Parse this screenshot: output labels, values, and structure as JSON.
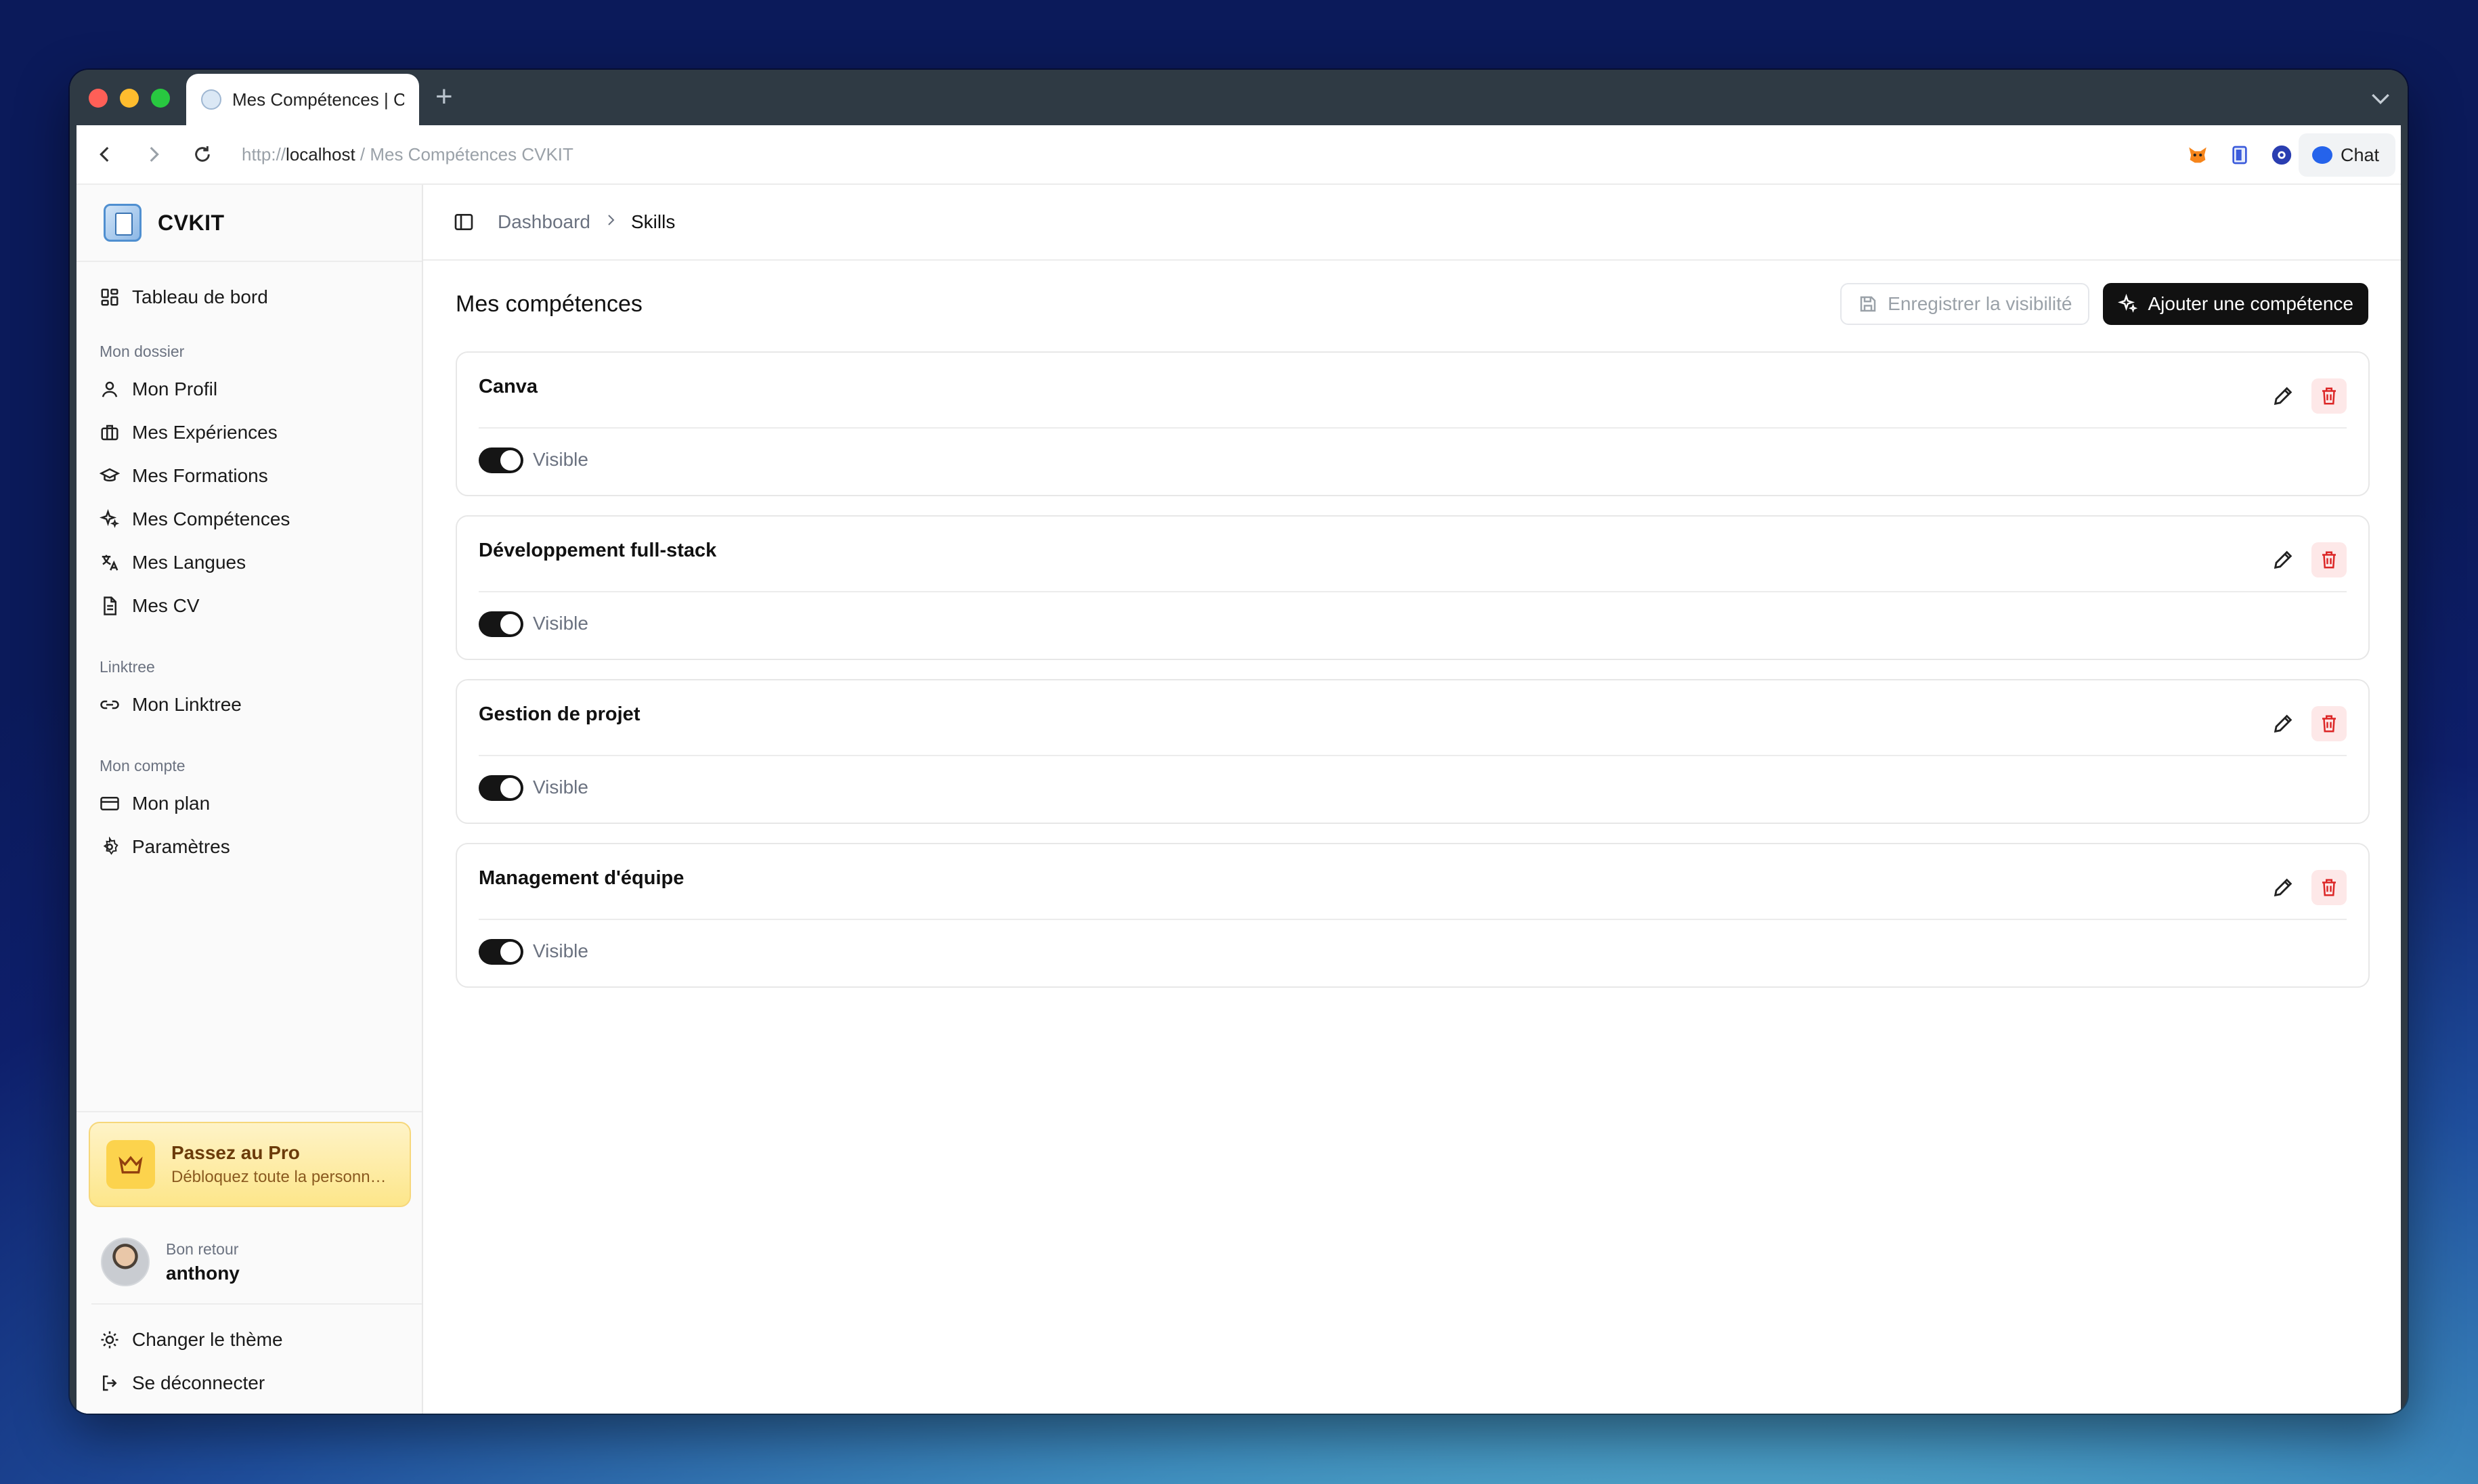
{
  "browser": {
    "tab_title": "Mes Compétences | C\\",
    "new_tab": "+",
    "url_scheme": "http://",
    "url_host": "localhost",
    "url_rest": " / Mes Compétences CVKIT",
    "chat_label": "Chat"
  },
  "sidebar": {
    "brand": "CVKIT",
    "dashboard": "Tableau de bord",
    "section_dossier": "Mon dossier",
    "dossier_items": [
      "Mon Profil",
      "Mes Expériences",
      "Mes Formations",
      "Mes Compétences",
      "Mes Langues",
      "Mes CV"
    ],
    "section_linktree": "Linktree",
    "linktree_item": "Mon Linktree",
    "section_compte": "Mon compte",
    "compte_items": [
      "Mon plan",
      "Paramètres"
    ],
    "promo": {
      "title": "Passez au Pro",
      "subtitle": "Débloquez toute la personna…"
    },
    "user": {
      "greeting": "Bon retour",
      "name": "anthony"
    },
    "bottom_items": [
      "Changer le thème",
      "Se déconnecter"
    ]
  },
  "breadcrumb": {
    "parent": "Dashboard",
    "current": "Skills"
  },
  "page": {
    "title": "Mes compétences",
    "save_visibility": "Enregistrer la visibilité",
    "add_skill": "Ajouter une compétence"
  },
  "skills": [
    {
      "name": "Canva",
      "visible_label": "Visible",
      "visible": true
    },
    {
      "name": "Développement full-stack",
      "visible_label": "Visible",
      "visible": true
    },
    {
      "name": "Gestion de projet",
      "visible_label": "Visible",
      "visible": true
    },
    {
      "name": "Management d'équipe",
      "visible_label": "Visible",
      "visible": true
    }
  ],
  "colors": {
    "primary": "#111111",
    "delete_bg": "#fde8e8",
    "delete_icon": "#dc2626",
    "promo_bg": "#fde68a"
  }
}
